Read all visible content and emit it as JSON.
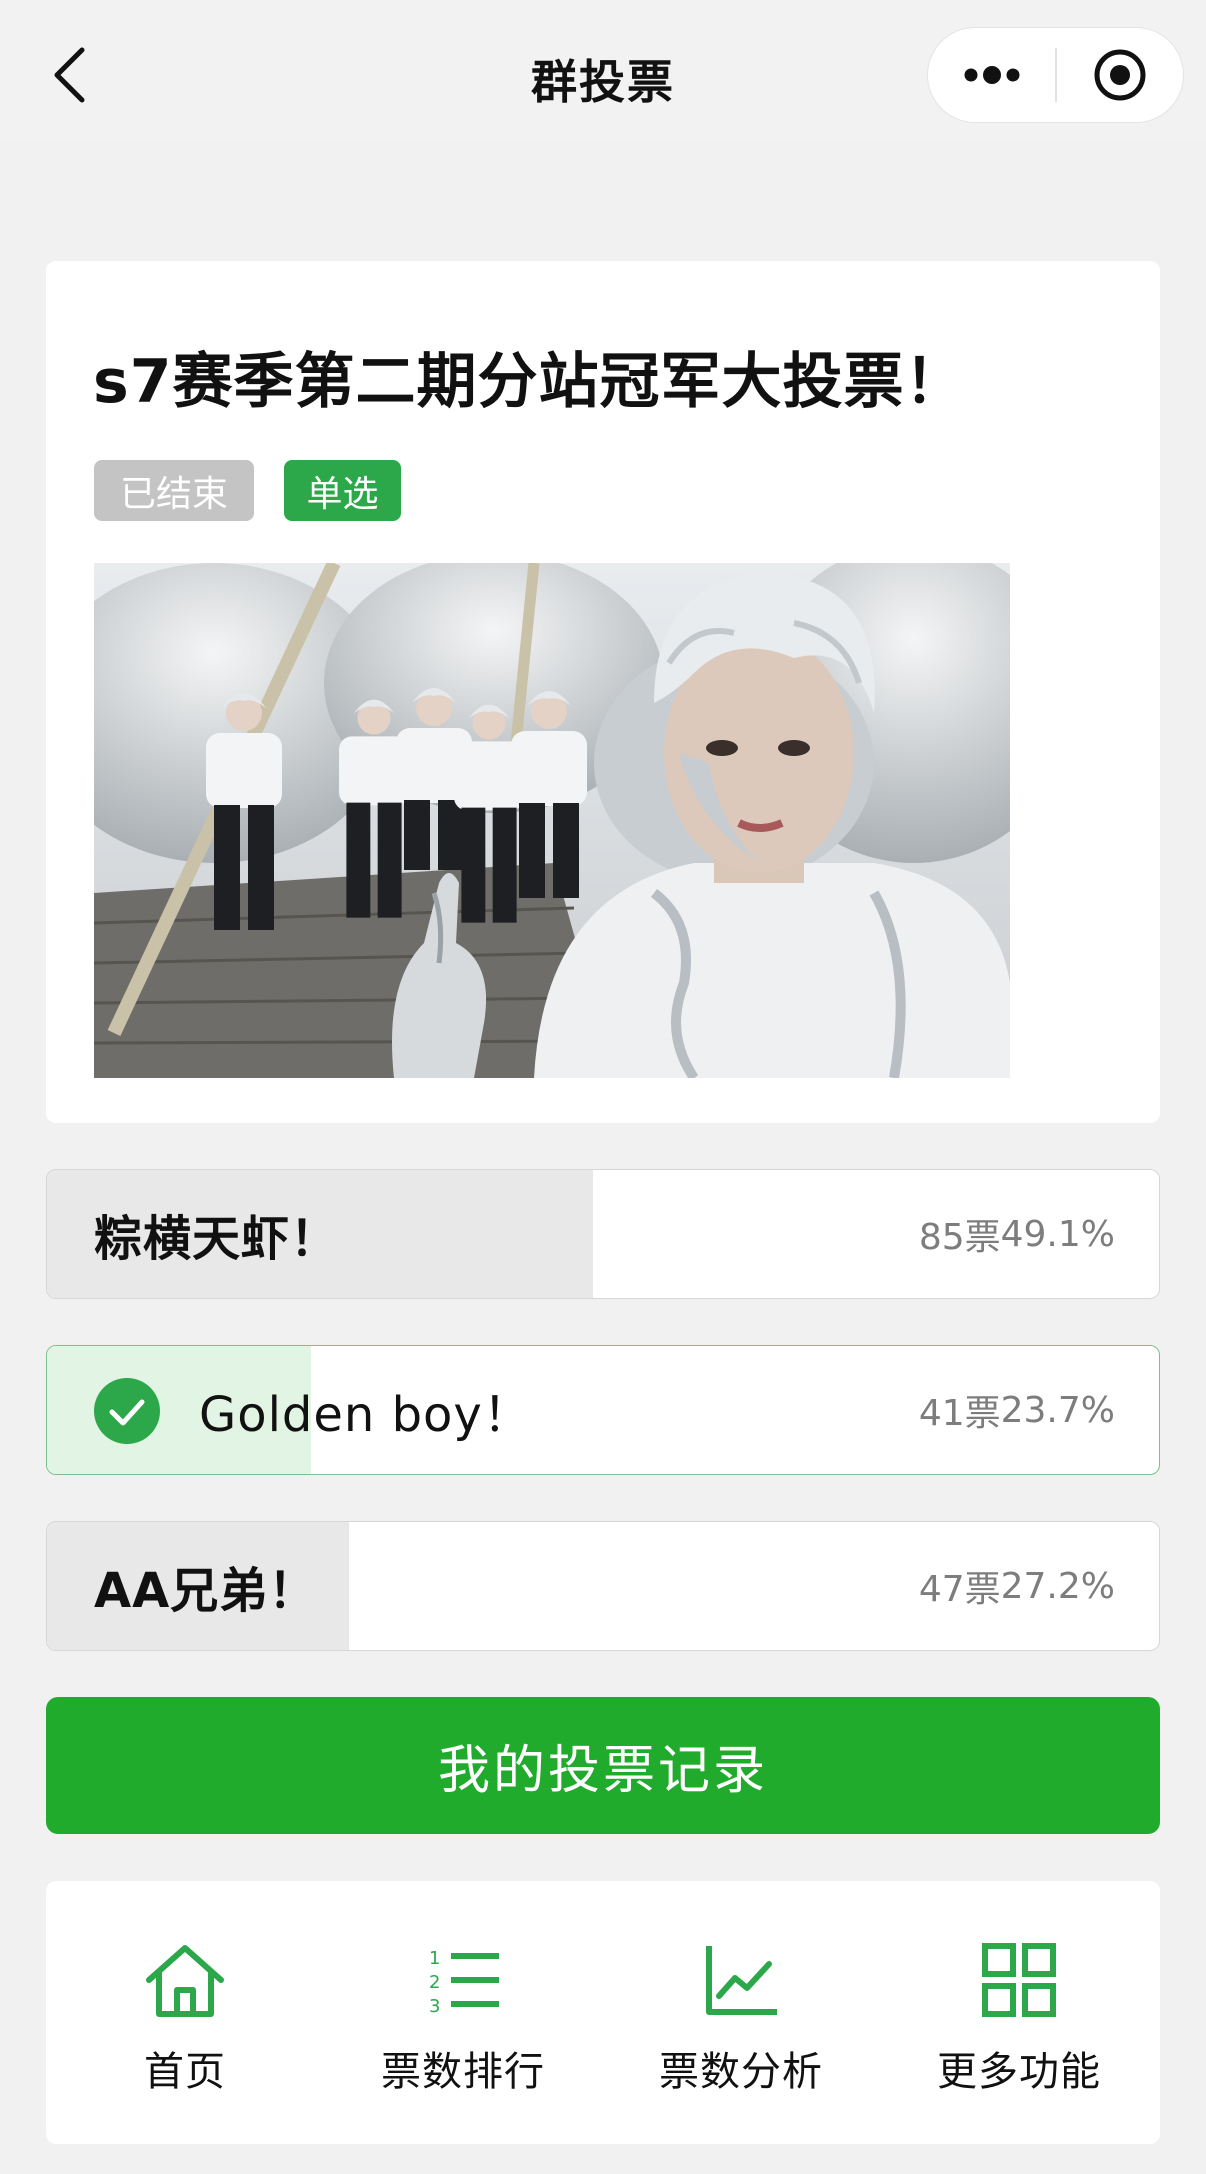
{
  "navbar": {
    "title": "群投票",
    "back_icon": "chevron-left-icon",
    "more_icon": "more-dots-icon",
    "close_icon": "target-close-icon"
  },
  "poll": {
    "title": "s7赛季第二期分站冠军大投票！",
    "status_tag": "已结束",
    "type_tag": "单选",
    "image_alt": "poll-photo"
  },
  "options": [
    {
      "label": "粽横天虾！",
      "votes": "85票",
      "percent": "49.1%",
      "fraction": 0.491,
      "selected": false
    },
    {
      "label": "Golden boy！",
      "votes": "41票",
      "percent": "23.7%",
      "fraction": 0.237,
      "selected": true
    },
    {
      "label": "AA兄弟！",
      "votes": "47票",
      "percent": "27.2%",
      "fraction": 0.272,
      "selected": false
    }
  ],
  "record_button": "我的投票记录",
  "functions": [
    {
      "label": "首页",
      "icon": "home-icon"
    },
    {
      "label": "票数排行",
      "icon": "ranking-list-icon"
    },
    {
      "label": "票数分析",
      "icon": "line-chart-icon"
    },
    {
      "label": "更多功能",
      "icon": "grid-icon"
    }
  ],
  "colors": {
    "accent_green": "#21ab2c",
    "tag_green": "#2ca84a",
    "tag_gray": "#c4c4c4",
    "selected_fill": "#e2f4e4",
    "option_fill": "#e8e8e8"
  }
}
